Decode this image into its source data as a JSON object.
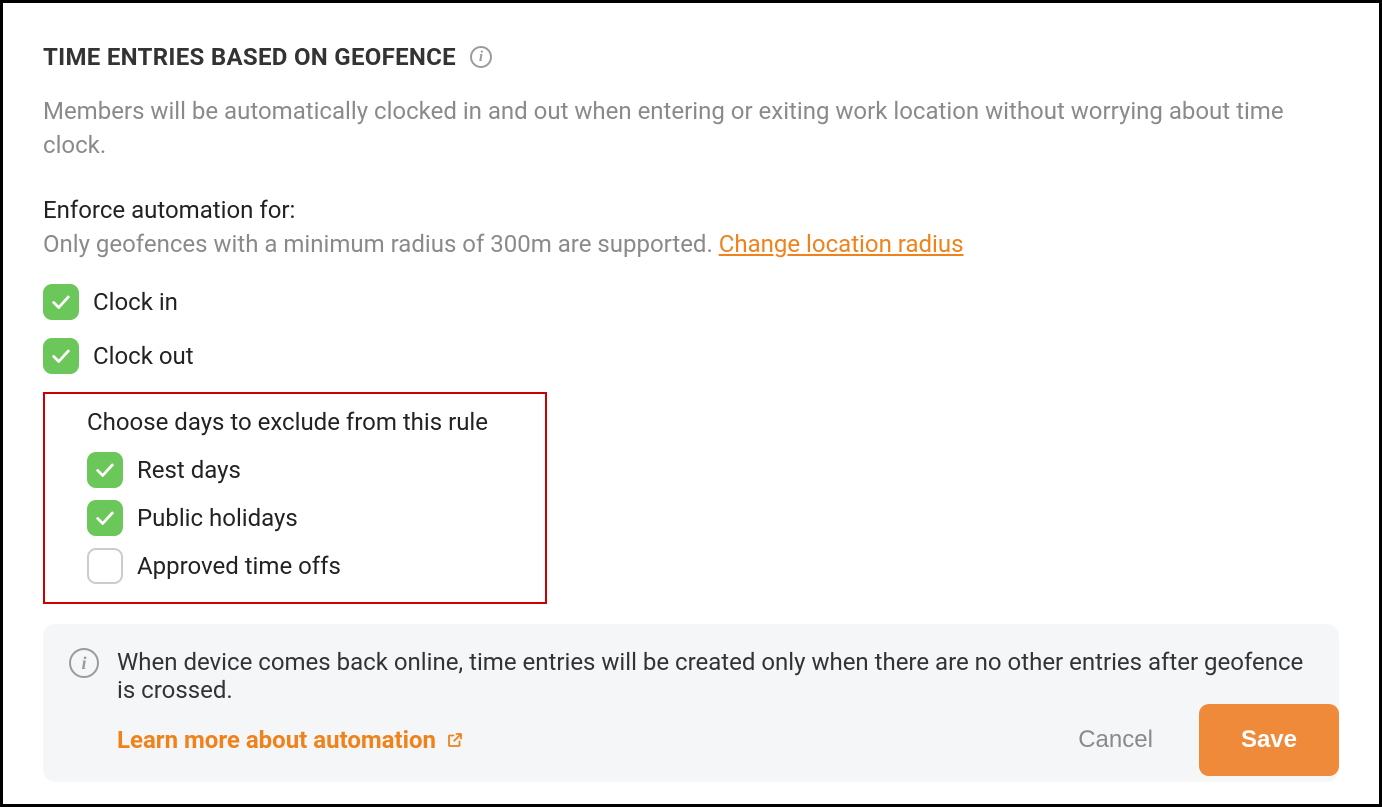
{
  "header": {
    "title": "TIME ENTRIES BASED ON GEOFENCE",
    "subtitle": "Members will be automatically clocked in and out when entering or exiting work location without worrying about time clock."
  },
  "enforce": {
    "label": "Enforce automation for:",
    "hint": "Only geofences with a minimum radius of 300m are supported. ",
    "change_link": "Change location radius"
  },
  "checks": {
    "clock_in": "Clock in",
    "clock_out": "Clock out"
  },
  "exclude": {
    "title": "Choose days to exclude from this rule",
    "rest_days": "Rest days",
    "public_holidays": "Public holidays",
    "approved_time_offs": "Approved time offs"
  },
  "info": {
    "text": "When device comes back online, time entries will be created only when there are no other entries after geofence is crossed.",
    "link": "Learn more about automation"
  },
  "footer": {
    "cancel": "Cancel",
    "save": "Save"
  }
}
